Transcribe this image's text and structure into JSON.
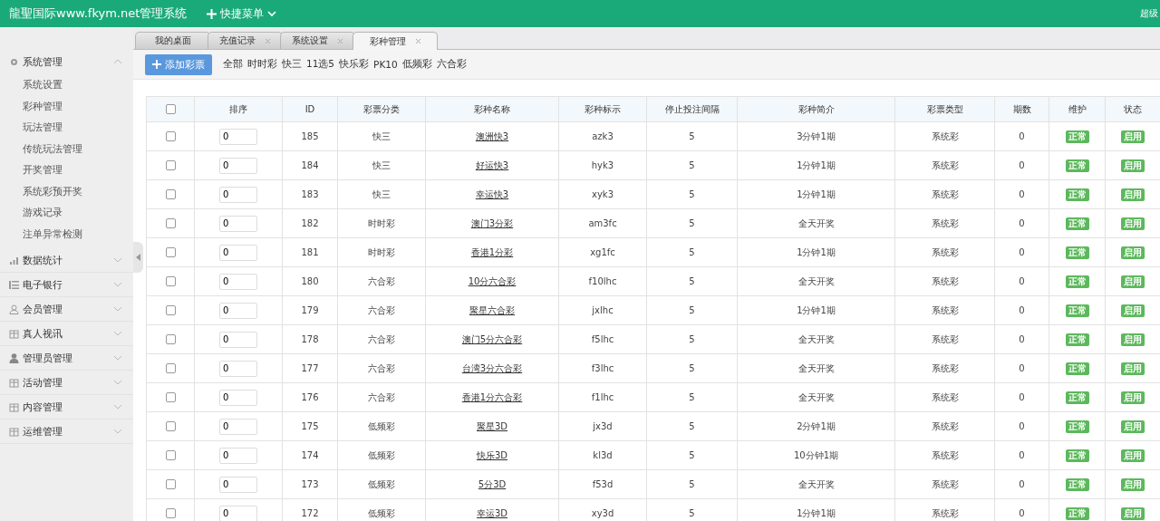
{
  "header": {
    "title": "龍聖国际www.fkym.net管理系统",
    "quick_menu": "快捷菜单",
    "user": "超级"
  },
  "sidebar": [
    {
      "label": "系统管理",
      "expanded": true,
      "children": [
        {
          "label": "系统设置"
        },
        {
          "label": "彩种管理"
        },
        {
          "label": "玩法管理"
        },
        {
          "label": "传统玩法管理"
        },
        {
          "label": "开奖管理"
        },
        {
          "label": "系统彩预开奖"
        },
        {
          "label": "游戏记录"
        },
        {
          "label": "注单异常检测"
        }
      ]
    },
    {
      "label": "数据统计",
      "expanded": false
    },
    {
      "label": "电子银行",
      "expanded": false
    },
    {
      "label": "会员管理",
      "expanded": false
    },
    {
      "label": "真人视讯",
      "expanded": false
    },
    {
      "label": "管理员管理",
      "expanded": false
    },
    {
      "label": "活动管理",
      "expanded": false
    },
    {
      "label": "内容管理",
      "expanded": false
    },
    {
      "label": "运维管理",
      "expanded": false
    }
  ],
  "tabs": [
    {
      "label": "我的桌面",
      "selected": false,
      "closable": false
    },
    {
      "label": "充值记录",
      "selected": false,
      "closable": true
    },
    {
      "label": "系统设置",
      "selected": false,
      "closable": true
    },
    {
      "label": "彩种管理",
      "selected": true,
      "closable": true
    }
  ],
  "toolbar": {
    "add_button": "添加彩票",
    "filters": [
      "全部",
      "时时彩",
      "快三",
      "11选5",
      "快乐彩",
      "PK10",
      "低频彩",
      "六合彩"
    ]
  },
  "table": {
    "select_all_checked": false,
    "columns": [
      "排序",
      "ID",
      "彩票分类",
      "彩种名称",
      "彩种标示",
      "停止投注间隔",
      "彩种简介",
      "彩票类型",
      "期数",
      "维护",
      "状态"
    ],
    "rows": [
      {
        "checked": false,
        "order": "0",
        "id": "185",
        "category": "快三",
        "name": "澳洲快3",
        "code": "azk3",
        "interval": "5",
        "intro": "3分钟1期",
        "type": "系统彩",
        "periods": "0",
        "maintenance": "正常",
        "status": "启用"
      },
      {
        "checked": false,
        "order": "0",
        "id": "184",
        "category": "快三",
        "name": "好运快3",
        "code": "hyk3",
        "interval": "5",
        "intro": "1分钟1期",
        "type": "系统彩",
        "periods": "0",
        "maintenance": "正常",
        "status": "启用"
      },
      {
        "checked": false,
        "order": "0",
        "id": "183",
        "category": "快三",
        "name": "幸运快3",
        "code": "xyk3",
        "interval": "5",
        "intro": "1分钟1期",
        "type": "系统彩",
        "periods": "0",
        "maintenance": "正常",
        "status": "启用"
      },
      {
        "checked": false,
        "order": "0",
        "id": "182",
        "category": "时时彩",
        "name": "澳门3分彩",
        "code": "am3fc",
        "interval": "5",
        "intro": "全天开奖",
        "type": "系统彩",
        "periods": "0",
        "maintenance": "正常",
        "status": "启用"
      },
      {
        "checked": false,
        "order": "0",
        "id": "181",
        "category": "时时彩",
        "name": "香港1分彩",
        "code": "xg1fc",
        "interval": "5",
        "intro": "1分钟1期",
        "type": "系统彩",
        "periods": "0",
        "maintenance": "正常",
        "status": "启用"
      },
      {
        "checked": false,
        "order": "0",
        "id": "180",
        "category": "六合彩",
        "name": "10分六合彩",
        "code": "f10lhc",
        "interval": "5",
        "intro": "全天开奖",
        "type": "系统彩",
        "periods": "0",
        "maintenance": "正常",
        "status": "启用"
      },
      {
        "checked": false,
        "order": "0",
        "id": "179",
        "category": "六合彩",
        "name": "聚星六合彩",
        "code": "jxlhc",
        "interval": "5",
        "intro": "1分钟1期",
        "type": "系统彩",
        "periods": "0",
        "maintenance": "正常",
        "status": "启用"
      },
      {
        "checked": false,
        "order": "0",
        "id": "178",
        "category": "六合彩",
        "name": "澳门5分六合彩",
        "code": "f5lhc",
        "interval": "5",
        "intro": "全天开奖",
        "type": "系统彩",
        "periods": "0",
        "maintenance": "正常",
        "status": "启用"
      },
      {
        "checked": false,
        "order": "0",
        "id": "177",
        "category": "六合彩",
        "name": "台湾3分六合彩",
        "code": "f3lhc",
        "interval": "5",
        "intro": "全天开奖",
        "type": "系统彩",
        "periods": "0",
        "maintenance": "正常",
        "status": "启用"
      },
      {
        "checked": false,
        "order": "0",
        "id": "176",
        "category": "六合彩",
        "name": "香港1分六合彩",
        "code": "f1lhc",
        "interval": "5",
        "intro": "全天开奖",
        "type": "系统彩",
        "periods": "0",
        "maintenance": "正常",
        "status": "启用"
      },
      {
        "checked": false,
        "order": "0",
        "id": "175",
        "category": "低频彩",
        "name": "聚星3D",
        "code": "jx3d",
        "interval": "5",
        "intro": "2分钟1期",
        "type": "系统彩",
        "periods": "0",
        "maintenance": "正常",
        "status": "启用"
      },
      {
        "checked": false,
        "order": "0",
        "id": "174",
        "category": "低频彩",
        "name": "快乐3D",
        "code": "kl3d",
        "interval": "5",
        "intro": "10分钟1期",
        "type": "系统彩",
        "periods": "0",
        "maintenance": "正常",
        "status": "启用"
      },
      {
        "checked": false,
        "order": "0",
        "id": "173",
        "category": "低频彩",
        "name": "5分3D",
        "code": "f53d",
        "interval": "5",
        "intro": "全天开奖",
        "type": "系统彩",
        "periods": "0",
        "maintenance": "正常",
        "status": "启用"
      },
      {
        "checked": false,
        "order": "0",
        "id": "172",
        "category": "低频彩",
        "name": "幸运3D",
        "code": "xy3d",
        "interval": "5",
        "intro": "1分钟1期",
        "type": "系统彩",
        "periods": "0",
        "maintenance": "正常",
        "status": "启用"
      }
    ]
  }
}
